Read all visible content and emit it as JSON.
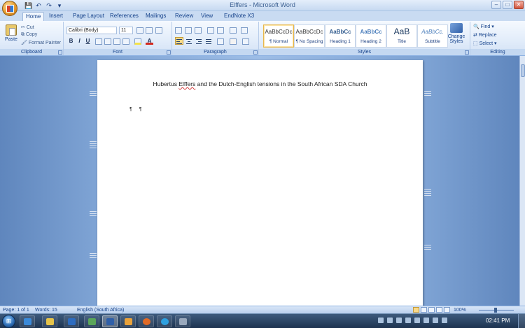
{
  "window": {
    "title": "Elffers - Microsoft Word",
    "controls": [
      "–",
      "□",
      "✕"
    ]
  },
  "qat": {
    "save": "💾",
    "undo": "↶",
    "redo": "↷",
    "more": "▾"
  },
  "tabs": [
    {
      "label": "Home"
    },
    {
      "label": "Insert"
    },
    {
      "label": "Page Layout"
    },
    {
      "label": "References"
    },
    {
      "label": "Mailings"
    },
    {
      "label": "Review"
    },
    {
      "label": "View"
    },
    {
      "label": "EndNote X3"
    }
  ],
  "ribbon": {
    "clipboard": {
      "label": "Clipboard",
      "paste": "Paste",
      "cut": "Cut",
      "copy": "Copy",
      "format_painter": "Format Painter"
    },
    "font": {
      "label": "Font",
      "font_name": "Calibri (Body)",
      "font_size": "11",
      "bold": "B",
      "italic": "I",
      "underline": "U",
      "font_color": "A"
    },
    "paragraph": {
      "label": "Paragraph"
    },
    "styles": {
      "label": "Styles",
      "items": [
        {
          "preview": "AaBbCcDc",
          "name": "¶ Normal"
        },
        {
          "preview": "AaBbCcDc",
          "name": "¶ No Spacing"
        },
        {
          "preview": "AaBbCc",
          "name": "Heading 1"
        },
        {
          "preview": "AaBbCc",
          "name": "Heading 2"
        },
        {
          "preview": "AaB",
          "name": "Title"
        },
        {
          "preview": "AaBbCc.",
          "name": "Subtitle"
        }
      ],
      "change_styles": "Change Styles"
    },
    "editing": {
      "label": "Editing",
      "find": "Find",
      "replace": "Replace",
      "select": "Select"
    }
  },
  "document": {
    "title_word_1": "Hubertus",
    "title_word_2": "Elffers",
    "title_rest": "and the Dutch-English tensions in the South African SDA Church",
    "para_marks": "¶ ¶"
  },
  "statusbar": {
    "page": "Page: 1 of 1",
    "words": "Words: 15",
    "language": "English (South Africa)",
    "zoom": "100%"
  },
  "taskbar": {
    "start": "⊞",
    "clock": "02:41 PM"
  },
  "colors": {
    "ribbon_text": "#15428b",
    "doc_background": "#7ea3d4",
    "page": "#ffffff",
    "spell_error": "#d23b3b"
  }
}
